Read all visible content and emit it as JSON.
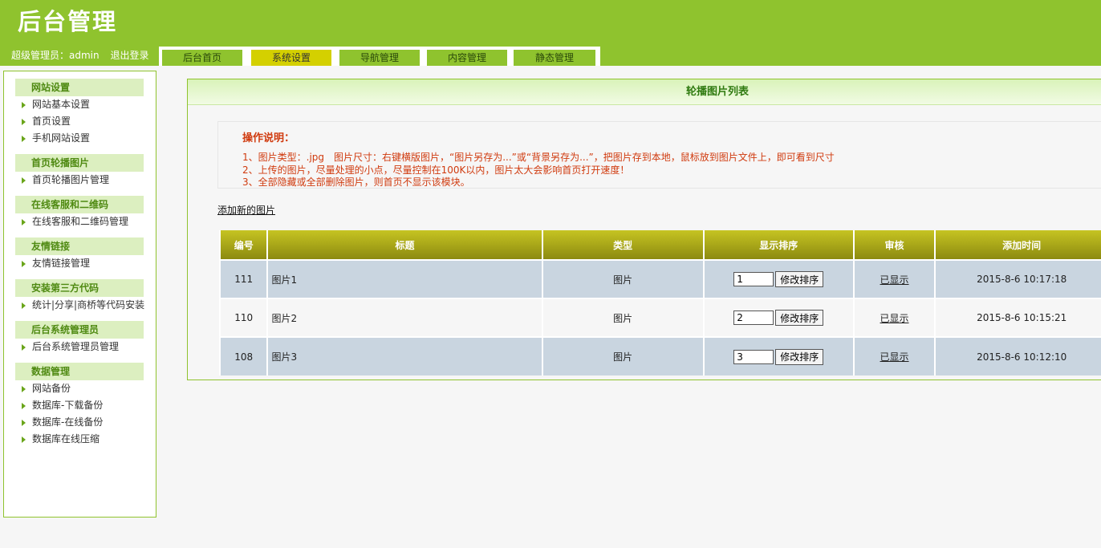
{
  "header": {
    "logo": "后台管理",
    "admin_label": "超级管理员：admin",
    "logout": "退出登录"
  },
  "nav": {
    "tabs": [
      {
        "label": "后台首页",
        "active": false
      },
      {
        "label": "系统设置",
        "active": true
      },
      {
        "label": "导航管理",
        "active": false
      },
      {
        "label": "内容管理",
        "active": false
      },
      {
        "label": "静态管理",
        "active": false
      }
    ]
  },
  "sidebar": {
    "groups": [
      {
        "title": "网站设置",
        "items": [
          "网站基本设置",
          "首页设置",
          "手机网站设置"
        ]
      },
      {
        "title": "首页轮播图片",
        "items": [
          "首页轮播图片管理"
        ]
      },
      {
        "title": "在线客服和二维码",
        "items": [
          "在线客服和二维码管理"
        ]
      },
      {
        "title": "友情链接",
        "items": [
          "友情链接管理"
        ]
      },
      {
        "title": "安装第三方代码",
        "items": [
          "统计|分享|商桥等代码安装"
        ]
      },
      {
        "title": "后台系统管理员",
        "items": [
          "后台系统管理员管理"
        ]
      },
      {
        "title": "数据管理",
        "items": [
          "网站备份",
          "数据库-下载备份",
          "数据库-在线备份",
          "数据库在线压缩"
        ]
      }
    ]
  },
  "panel": {
    "title": "轮播图片列表",
    "notes_title": "操作说明：",
    "notes": [
      "1、图片类型：.jpg　图片尺寸：右键横版图片，“图片另存为...”或“背景另存为...”，把图片存到本地，鼠标放到图片文件上，即可看到尺寸",
      "2、上传的图片，尽量处理的小点，尽量控制在100K以内，图片太大会影响首页打开速度！",
      "3、全部隐藏或全部删除图片，则首页不显示该模块。"
    ],
    "add_link": "添加新的图片"
  },
  "table": {
    "headers": [
      "编号",
      "标题",
      "类型",
      "显示排序",
      "审核",
      "添加时间"
    ],
    "sort_button": "修改排序",
    "rows": [
      {
        "id": "111",
        "title": "图片1",
        "type": "图片",
        "sort": "1",
        "status": "已显示",
        "time": "2015-8-6 10:17:18"
      },
      {
        "id": "110",
        "title": "图片2",
        "type": "图片",
        "sort": "2",
        "status": "已显示",
        "time": "2015-8-6 10:15:21"
      },
      {
        "id": "108",
        "title": "图片3",
        "type": "图片",
        "sort": "3",
        "status": "已显示",
        "time": "2015-8-6 10:12:10"
      }
    ]
  },
  "colors": {
    "brand_green": "#8fc32e",
    "active_tab": "#d4d000",
    "note_red": "#d03b0f",
    "row_blue": "#c9d5e0"
  }
}
